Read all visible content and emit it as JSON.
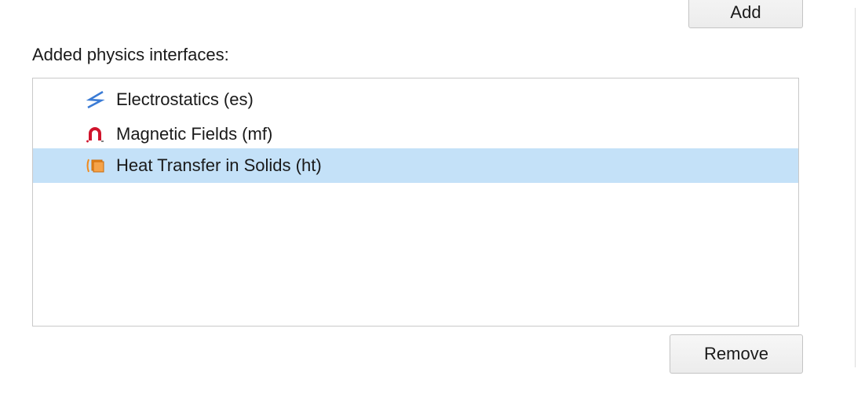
{
  "buttons": {
    "add_label": "Add",
    "remove_label": "Remove"
  },
  "section": {
    "label": "Added physics interfaces:"
  },
  "interfaces": [
    {
      "label": "Electrostatics (es)",
      "icon": "electrostatics-icon",
      "selected": false
    },
    {
      "label": "Magnetic Fields (mf)",
      "icon": "magnet-icon",
      "selected": false
    },
    {
      "label": "Heat Transfer in Solids (ht)",
      "icon": "heat-transfer-icon",
      "selected": true
    }
  ],
  "colors": {
    "selection": "#c4e1f8",
    "electrostatics": "#3a7bd5",
    "magnet": "#d0142c",
    "heat": "#f08a1c"
  }
}
